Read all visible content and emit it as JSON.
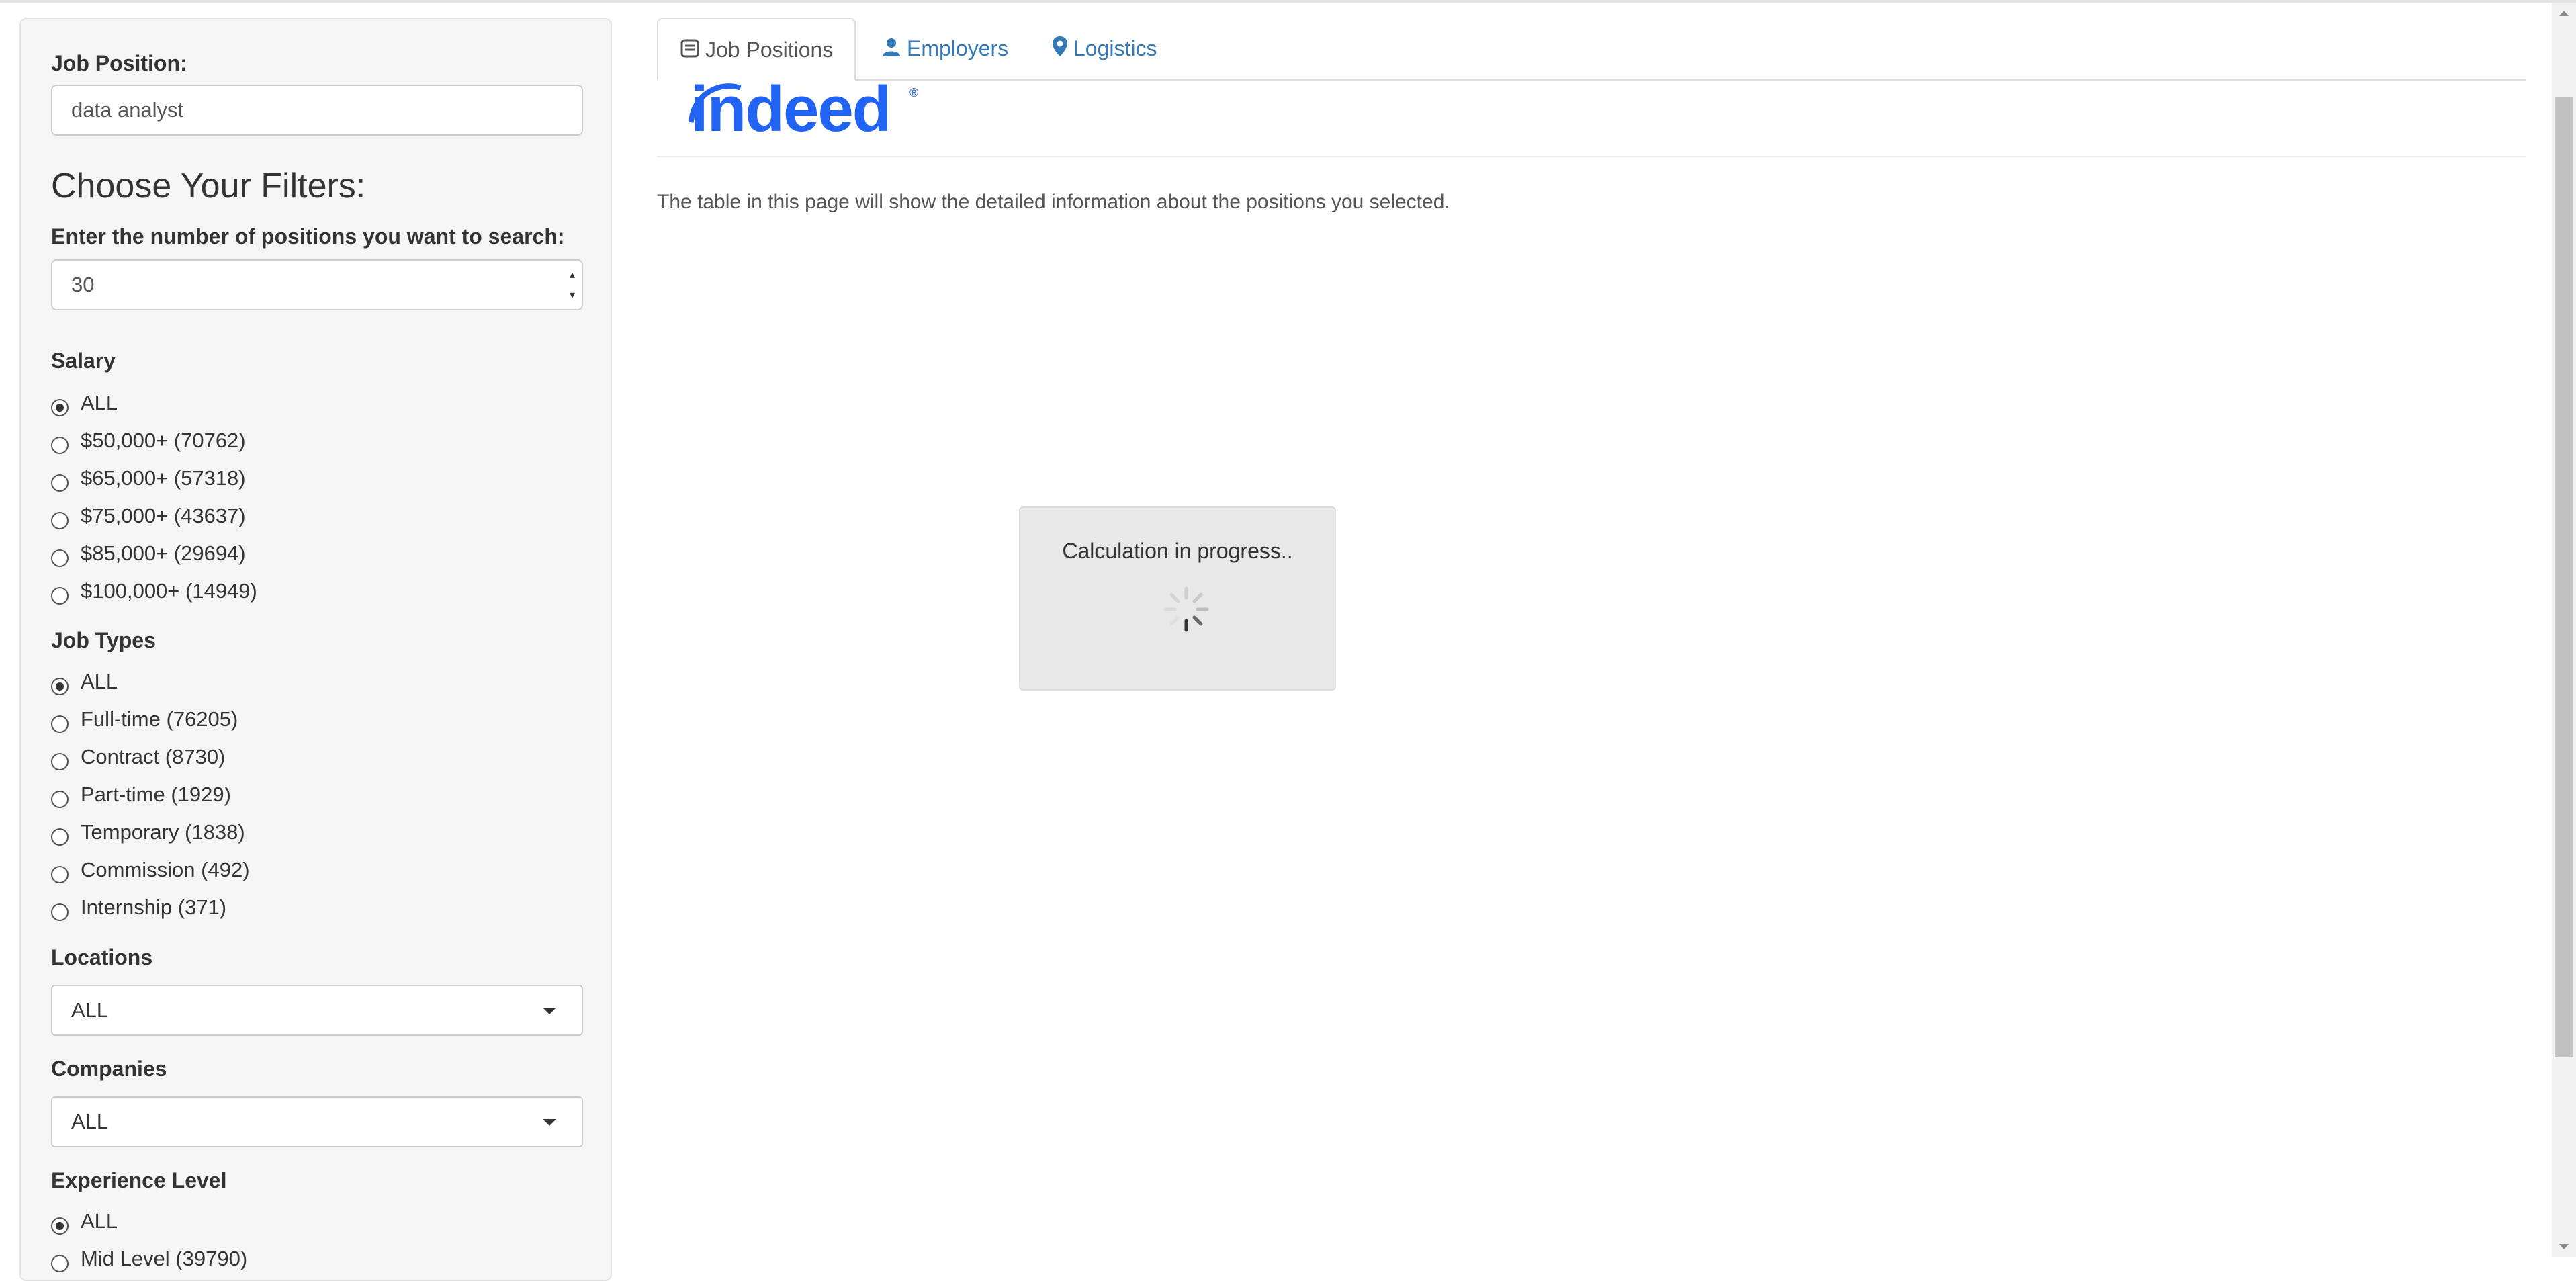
{
  "sidebar": {
    "job_position": {
      "label": "Job Position:",
      "value": "data analyst"
    },
    "filters_heading": "Choose Your Filters:",
    "num_positions": {
      "label": "Enter the number of positions you want to search:",
      "value": "30"
    },
    "salary": {
      "label": "Salary",
      "options": [
        "ALL",
        "$50,000+ (70762)",
        "$65,000+ (57318)",
        "$75,000+ (43637)",
        "$85,000+ (29694)",
        "$100,000+ (14949)"
      ],
      "selected": "ALL"
    },
    "job_types": {
      "label": "Job Types",
      "options": [
        "ALL",
        "Full-time (76205)",
        "Contract (8730)",
        "Part-time (1929)",
        "Temporary (1838)",
        "Commission (492)",
        "Internship (371)"
      ],
      "selected": "ALL"
    },
    "locations": {
      "label": "Locations",
      "value": "ALL"
    },
    "companies": {
      "label": "Companies",
      "value": "ALL"
    },
    "experience": {
      "label": "Experience Level",
      "options": [
        "ALL",
        "Mid Level (39790)"
      ],
      "selected": "ALL"
    }
  },
  "tabs": [
    {
      "label": "Job Positions",
      "icon": "list-alt-icon",
      "active": true
    },
    {
      "label": "Employers",
      "icon": "user-icon",
      "active": false
    },
    {
      "label": "Logistics",
      "icon": "map-marker-icon",
      "active": false
    }
  ],
  "logo": {
    "text": "indeed",
    "mark": "®"
  },
  "description": "The table in this page will show the detailed information about the positions you selected.",
  "progress": {
    "message": "Calculation in progress.."
  },
  "colors": {
    "link": "#337ab7",
    "brand": "#2164f3",
    "panel": "#f5f5f5"
  }
}
